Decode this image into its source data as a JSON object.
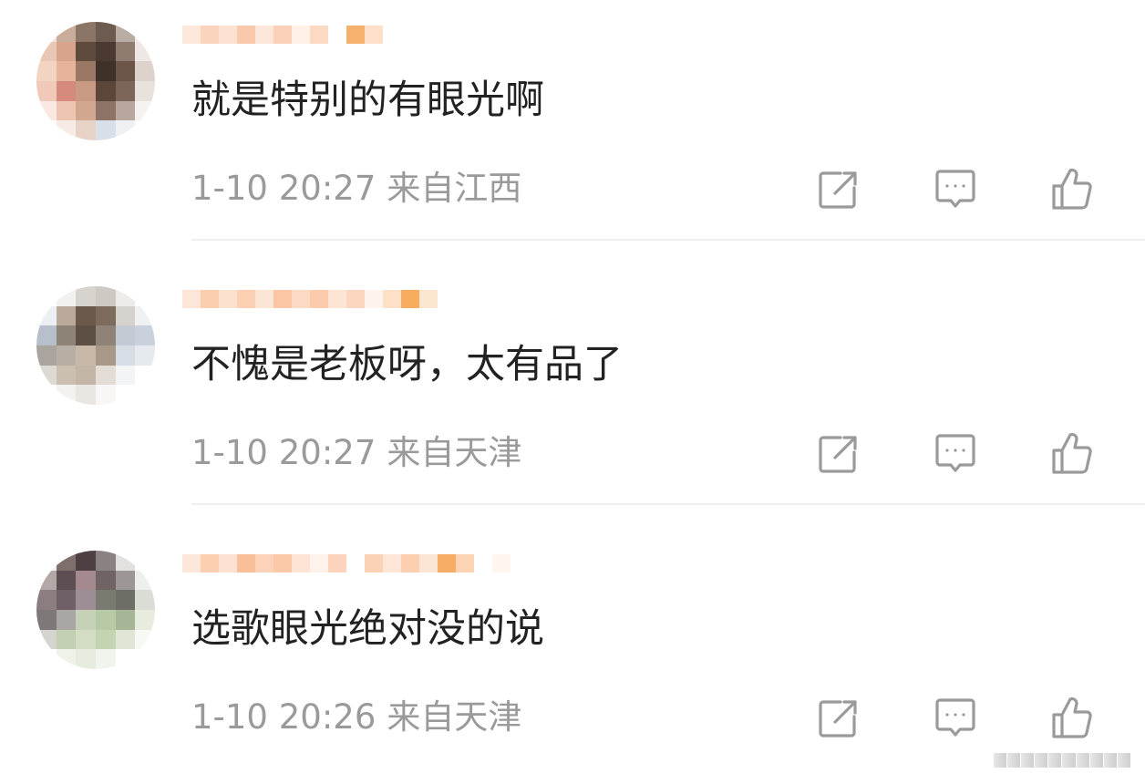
{
  "colors": {
    "text_primary": "#222222",
    "text_secondary": "#9a9a9a",
    "icon_stroke": "#9a9a9a",
    "divider": "#eeeeee",
    "username_mosaic": "#f7c39a",
    "username_badge": "#f5a442"
  },
  "icons": {
    "share": "share-icon",
    "reply": "comment-icon",
    "like": "thumbs-up-icon"
  },
  "comments": [
    {
      "text": "就是特别的有眼光啊",
      "time": "1-10 20:27",
      "location": "来自江西"
    },
    {
      "text": "不愧是老板呀，太有品了",
      "time": "1-10 20:27",
      "location": "来自天津"
    },
    {
      "text": "选歌眼光绝对没的说",
      "time": "1-10 20:26",
      "location": "来自天津"
    }
  ]
}
